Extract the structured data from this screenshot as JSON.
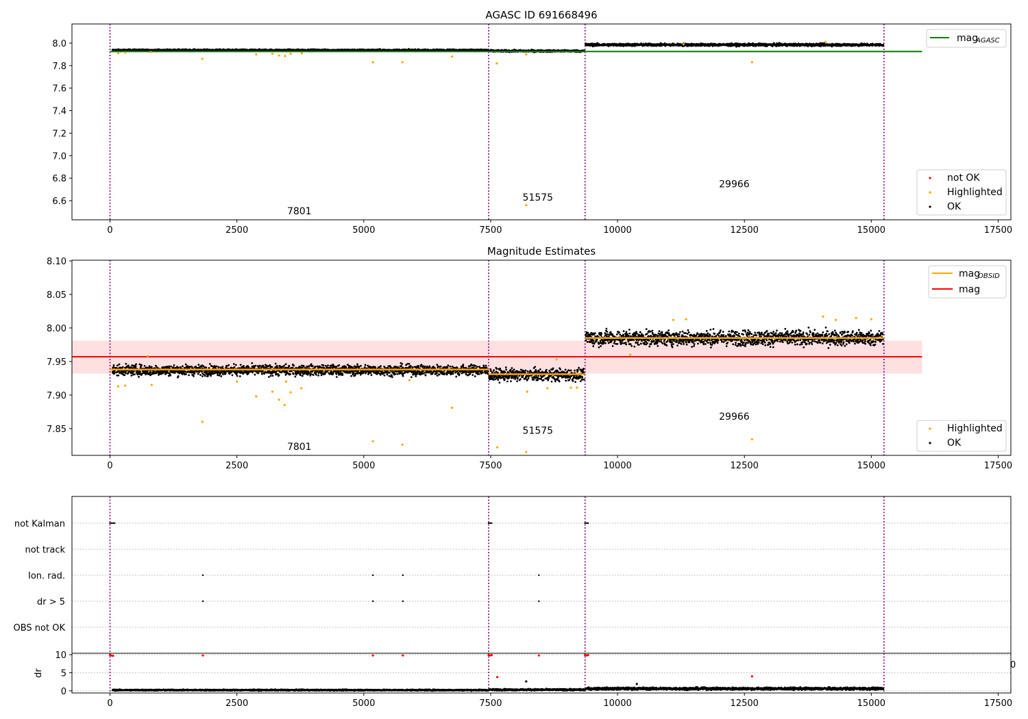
{
  "colors": {
    "ok": "#000000",
    "highlighted": "#ffa500",
    "not_ok": "#ff0000",
    "mag_agasc_line": "#008000",
    "mag_obsid_line": "#ffa500",
    "mag_line": "#ff0000",
    "mag_band": "#ffe0e0",
    "obsid_boundary": "#800080",
    "grid": "#b0b0b0"
  },
  "chart_data": [
    {
      "type": "scatter",
      "title": "AGASC ID 691668496",
      "xlabel": "",
      "ylabel": "",
      "xlim": [
        -750,
        17750
      ],
      "ylim": [
        6.43,
        8.17
      ],
      "xticks": [
        0,
        2500,
        5000,
        7500,
        10000,
        12500,
        15000,
        17500
      ],
      "yticks": [
        6.6,
        6.8,
        7.0,
        7.2,
        7.4,
        7.6,
        7.8,
        8.0
      ],
      "ytick_decimals": 1,
      "legend_lines": [
        {
          "label": "mag",
          "sub": "AGASC",
          "color": "#008000"
        }
      ],
      "legend_points": [
        {
          "label": "not OK",
          "color": "#ff0000"
        },
        {
          "label": "Highlighted",
          "color": "#ffa500"
        },
        {
          "label": "OK",
          "color": "#000000"
        }
      ],
      "obsid_boundaries": [
        0,
        7460,
        9360,
        15250
      ],
      "obsid_labels": [
        {
          "text": "7801",
          "x": 3730,
          "y": 6.48
        },
        {
          "text": "51575",
          "x": 8430,
          "y": 6.6
        },
        {
          "text": "29966",
          "x": 12300,
          "y": 6.72
        }
      ],
      "hlines": [
        {
          "name": "mag_AGASC",
          "y": 7.925,
          "x0": 0,
          "x1": 16000,
          "color": "#008000"
        }
      ],
      "series": [
        {
          "name": "OK",
          "segments": [
            {
              "x0": 50,
              "x1": 7450,
              "center": 7.937,
              "spread": 0.007
            },
            {
              "x0": 7470,
              "x1": 9350,
              "center": 7.93,
              "spread": 0.008
            },
            {
              "x0": 9370,
              "x1": 15240,
              "center": 7.985,
              "spread": 0.01
            }
          ]
        },
        {
          "name": "Highlighted",
          "points": [
            [
              160,
              7.91
            ],
            [
              300,
              7.915
            ],
            [
              800,
              7.92
            ],
            [
              1820,
              7.86
            ],
            [
              2880,
              7.9
            ],
            [
              3200,
              7.905
            ],
            [
              3330,
              7.89
            ],
            [
              3450,
              7.885
            ],
            [
              3560,
              7.905
            ],
            [
              3780,
              7.91
            ],
            [
              5180,
              7.83
            ],
            [
              5760,
              7.83
            ],
            [
              6740,
              7.88
            ],
            [
              7620,
              7.82
            ],
            [
              8200,
              6.56
            ],
            [
              8200,
              7.9
            ],
            [
              12650,
              7.83
            ],
            [
              11300,
              7.99
            ],
            [
              14100,
              8.01
            ]
          ]
        }
      ]
    },
    {
      "type": "scatter",
      "title": "Magnitude Estimates",
      "xlabel": "",
      "ylabel": "",
      "xlim": [
        -750,
        17750
      ],
      "ylim": [
        7.81,
        8.101
      ],
      "xticks": [
        0,
        2500,
        5000,
        7500,
        10000,
        12500,
        15000,
        17500
      ],
      "yticks": [
        7.85,
        7.9,
        7.95,
        8.0,
        8.05,
        8.1
      ],
      "ytick_decimals": 2,
      "legend_lines": [
        {
          "label": "mag",
          "sub": "OBSID",
          "color": "#ffa500"
        },
        {
          "label": "mag",
          "sub": "",
          "color": "#ff0000"
        }
      ],
      "legend_points": [
        {
          "label": "Highlighted",
          "color": "#ffa500"
        },
        {
          "label": "OK",
          "color": "#000000"
        }
      ],
      "obsid_boundaries": [
        0,
        7460,
        9360,
        15250
      ],
      "obsid_labels": [
        {
          "text": "7801",
          "x": 3730,
          "y": 7.818
        },
        {
          "text": "51575",
          "x": 8430,
          "y": 7.842
        },
        {
          "text": "29966",
          "x": 12300,
          "y": 7.863
        }
      ],
      "band": {
        "y0": 7.932,
        "y1": 7.981,
        "x0": -750,
        "x1": 16000
      },
      "hlines": [
        {
          "name": "mag",
          "y": 7.957,
          "x0": -750,
          "x1": 16000,
          "color": "#ff0000"
        }
      ],
      "segments_obsid": [
        {
          "x0": 0,
          "x1": 7460,
          "y": 7.938
        },
        {
          "x0": 7460,
          "x1": 9360,
          "y": 7.931
        },
        {
          "x0": 9360,
          "x1": 15250,
          "y": 7.985
        }
      ],
      "series": [
        {
          "name": "OK",
          "segments": [
            {
              "x0": 50,
              "x1": 7450,
              "center": 7.937,
              "spread": 0.007
            },
            {
              "x0": 7470,
              "x1": 9350,
              "center": 7.93,
              "spread": 0.008
            },
            {
              "x0": 9370,
              "x1": 15240,
              "center": 7.985,
              "spread": 0.01
            }
          ]
        },
        {
          "name": "Highlighted",
          "points": [
            [
              160,
              7.913
            ],
            [
              300,
              7.914
            ],
            [
              740,
              7.958
            ],
            [
              820,
              7.915
            ],
            [
              1820,
              7.86
            ],
            [
              2500,
              7.92
            ],
            [
              2880,
              7.898
            ],
            [
              3200,
              7.905
            ],
            [
              3330,
              7.893
            ],
            [
              3440,
              7.885
            ],
            [
              3470,
              7.92
            ],
            [
              3560,
              7.904
            ],
            [
              3770,
              7.91
            ],
            [
              5180,
              7.831
            ],
            [
              5760,
              7.826
            ],
            [
              5900,
              7.922
            ],
            [
              6740,
              7.881
            ],
            [
              7630,
              7.822
            ],
            [
              8220,
              7.905
            ],
            [
              8200,
              7.815
            ],
            [
              8620,
              7.91
            ],
            [
              8800,
              7.953
            ],
            [
              9080,
              7.911
            ],
            [
              9200,
              7.911
            ],
            [
              10250,
              7.96
            ],
            [
              11100,
              8.012
            ],
            [
              11350,
              8.013
            ],
            [
              12650,
              7.834
            ],
            [
              14050,
              8.017
            ],
            [
              14300,
              8.012
            ],
            [
              14700,
              8.015
            ],
            [
              15000,
              8.013
            ]
          ]
        }
      ]
    },
    {
      "type": "scatter",
      "title": "",
      "xlabel": "",
      "ylabel": "",
      "xlim": [
        -750,
        17750
      ],
      "categories": [
        "not Kalman",
        "not track",
        "Ion. rad.",
        "dr > 5",
        "OBS not OK"
      ],
      "obsid_boundaries": [
        0,
        7460,
        9360,
        15250
      ],
      "flag_points": {
        "not Kalman": [
          0,
          30,
          60,
          90,
          7460,
          7490,
          7520,
          9360,
          9390,
          9420
        ],
        "not track": [],
        "Ion. rad.": [
          1830,
          5180,
          5770,
          8450
        ],
        "dr > 5": [
          1830,
          5180,
          5770,
          8450
        ],
        "OBS not OK": []
      }
    },
    {
      "type": "scatter",
      "title": "",
      "xlabel": "",
      "ylabel": "dr",
      "xlim": [
        -750,
        17750
      ],
      "ylim": [
        -0.6,
        10.4
      ],
      "xticks": [
        0,
        2500,
        5000,
        7500,
        10000,
        12500,
        15000,
        17500
      ],
      "yticks": [
        0,
        5,
        10
      ],
      "ytick_decimals": 0,
      "clipped_tick_label": "0",
      "obsid_boundaries": [
        0,
        7460,
        9360,
        15250
      ],
      "series": [
        {
          "name": "OK",
          "segments": [
            {
              "x0": 50,
              "x1": 7450,
              "center": 0.2,
              "spread": 0.15
            },
            {
              "x0": 7470,
              "x1": 9350,
              "center": 0.3,
              "spread": 0.2
            },
            {
              "x0": 9370,
              "x1": 15240,
              "center": 0.6,
              "spread": 0.3
            }
          ],
          "points": [
            [
              8200,
              2.6
            ],
            [
              10380,
              1.9
            ]
          ]
        },
        {
          "name": "not OK",
          "points": [
            [
              0,
              9.9
            ],
            [
              30,
              9.8
            ],
            [
              60,
              9.7
            ],
            [
              1830,
              9.8
            ],
            [
              5180,
              9.8
            ],
            [
              5770,
              9.8
            ],
            [
              7460,
              9.9
            ],
            [
              7490,
              9.8
            ],
            [
              7520,
              9.9
            ],
            [
              8450,
              9.8
            ],
            [
              9360,
              9.9
            ],
            [
              9390,
              9.8
            ],
            [
              9420,
              9.9
            ],
            [
              7630,
              3.8
            ],
            [
              12650,
              4.0
            ]
          ]
        }
      ]
    }
  ]
}
